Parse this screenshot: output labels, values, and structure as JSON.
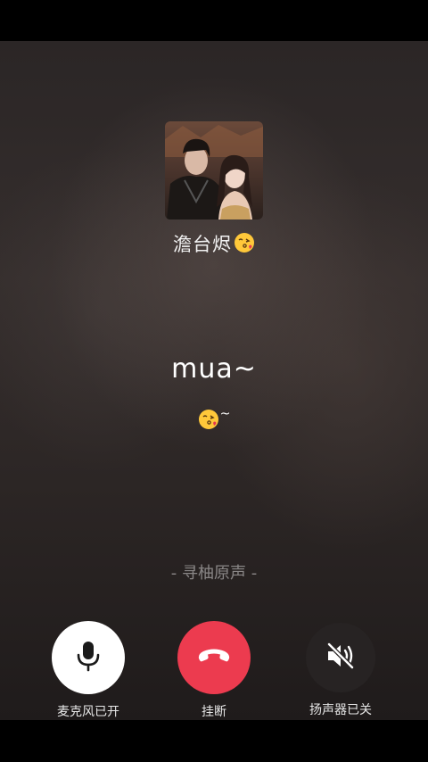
{
  "contact": {
    "name": "澹台烬",
    "name_emoji_icon": "kissing-face-emoji-icon"
  },
  "lyrics": {
    "main": "mua~",
    "sub_emoji_icon": "kissing-face-emoji-icon",
    "sub_tilde": "~"
  },
  "source_label": "- 寻柚原声 -",
  "controls": {
    "mic": {
      "label": "麦克风已开",
      "icon": "microphone-icon",
      "state": "on"
    },
    "hangup": {
      "label": "挂断",
      "icon": "phone-hangup-icon",
      "color": "#ec3b4f"
    },
    "speaker": {
      "label": "扬声器已关",
      "icon": "speaker-muted-icon",
      "state": "off"
    }
  }
}
